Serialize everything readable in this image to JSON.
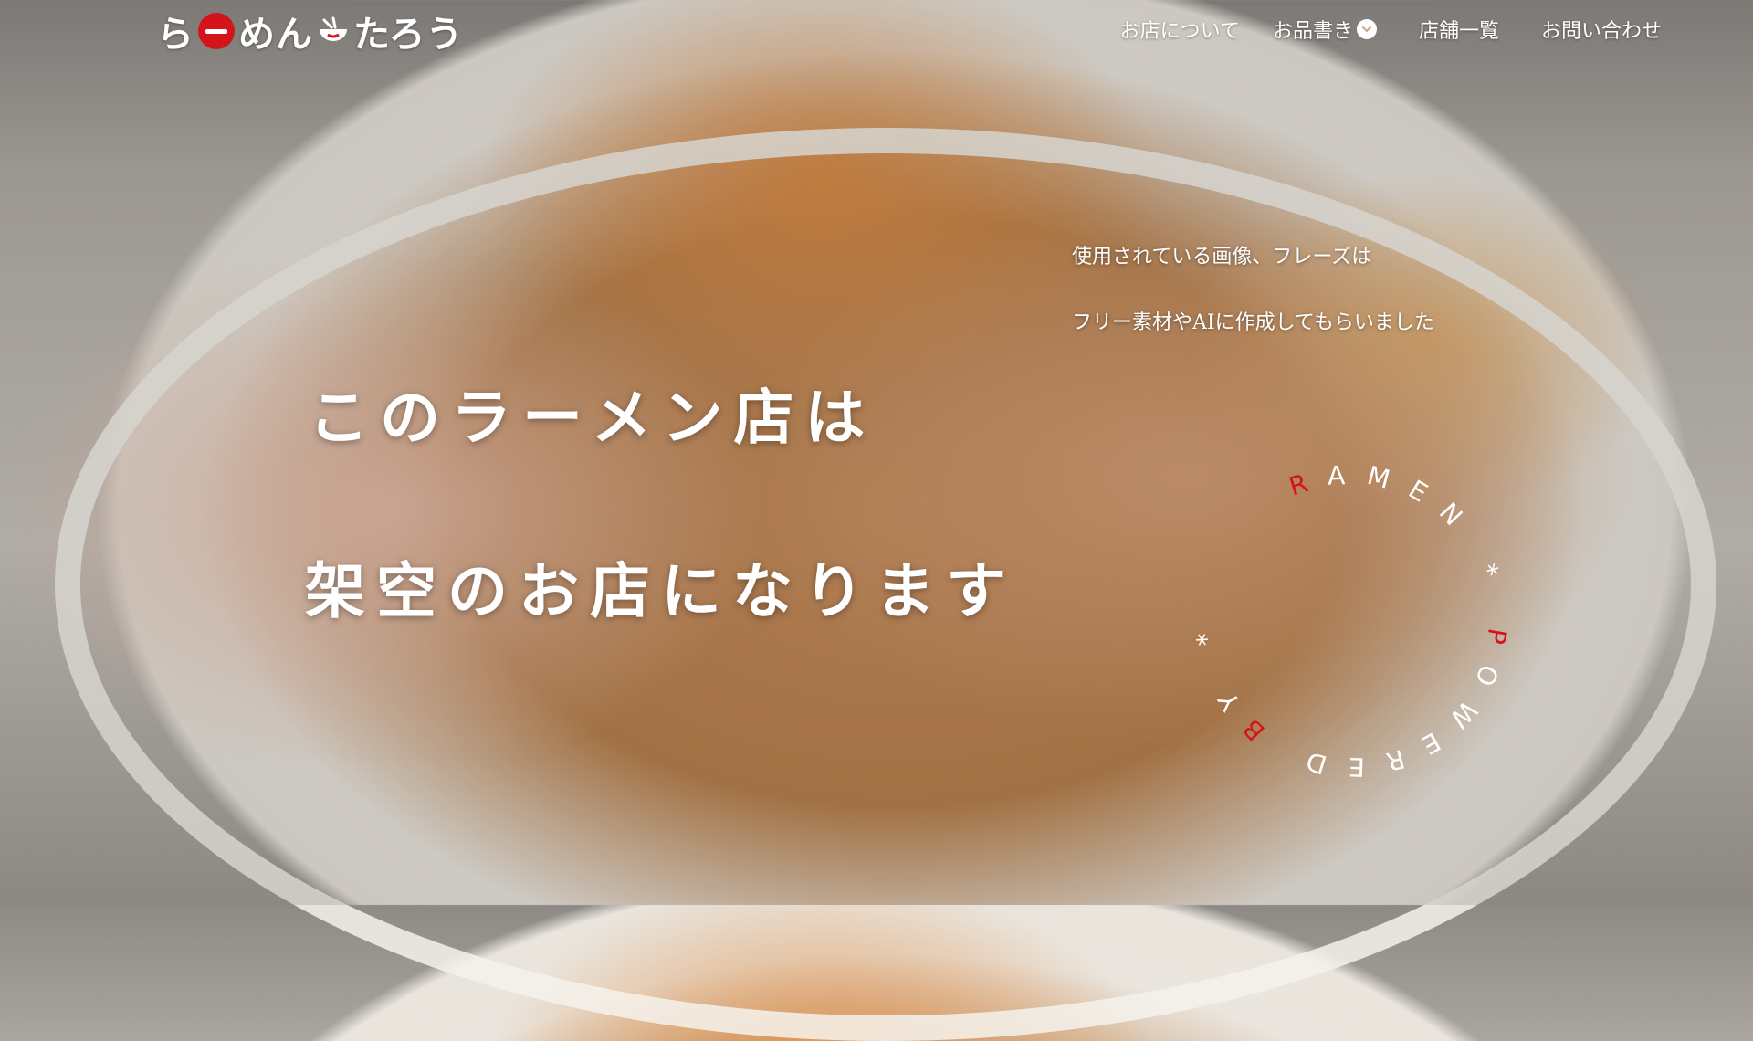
{
  "header": {
    "logo": {
      "part1": "ら",
      "part2": "めん",
      "part3": "たろう"
    },
    "nav": [
      {
        "label": "お店について"
      },
      {
        "label": "お品書き"
      },
      {
        "label": "店舗一覧"
      },
      {
        "label": "お問い合わせ"
      }
    ]
  },
  "notice": {
    "line1": "使用されている画像、フレーズは",
    "line2": "フリー素材やAIに作成してもらいました"
  },
  "hero": {
    "line1": "このラーメン店は",
    "line2": "架空のお店になります"
  },
  "badge": {
    "text": "RAMEN * POWERED BY *",
    "colors": {
      "primary": "#ffffff",
      "accent": "#d4141b"
    }
  },
  "colors": {
    "brand_red": "#d4141b",
    "text": "#ffffff"
  }
}
